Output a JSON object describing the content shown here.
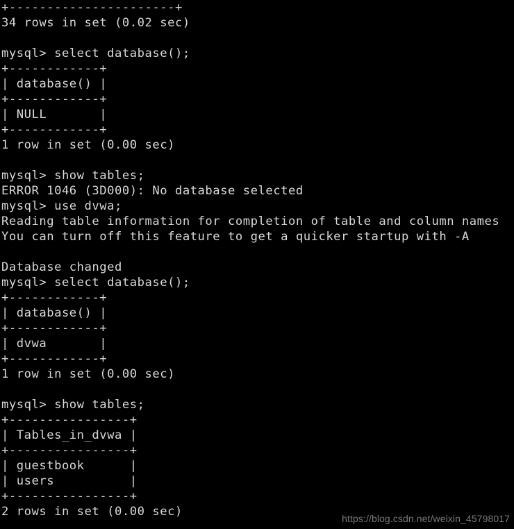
{
  "terminal": {
    "background_color": "#000000",
    "foreground_color": "#d8d8d8",
    "prompt": "mysql>",
    "lines": [
      "+----------------------+",
      "34 rows in set (0.02 sec)",
      "",
      "mysql> select database();",
      "+------------+",
      "| database() |",
      "+------------+",
      "| NULL       |",
      "+------------+",
      "1 row in set (0.00 sec)",
      "",
      "mysql> show tables;",
      "ERROR 1046 (3D000): No database selected",
      "mysql> use dvwa;",
      "Reading table information for completion of table and column names",
      "You can turn off this feature to get a quicker startup with -A",
      "",
      "Database changed",
      "mysql> select database();",
      "+------------+",
      "| database() |",
      "+------------+",
      "| dvwa       |",
      "+------------+",
      "1 row in set (0.00 sec)",
      "",
      "mysql> show tables;",
      "+----------------+",
      "| Tables_in_dvwa |",
      "+----------------+",
      "| guestbook      |",
      "| users          |",
      "+----------------+",
      "2 rows in set (0.00 sec)"
    ]
  },
  "watermark": {
    "text": "https://blog.csdn.net/weixin_45798017",
    "color": "#7a7a7a"
  }
}
